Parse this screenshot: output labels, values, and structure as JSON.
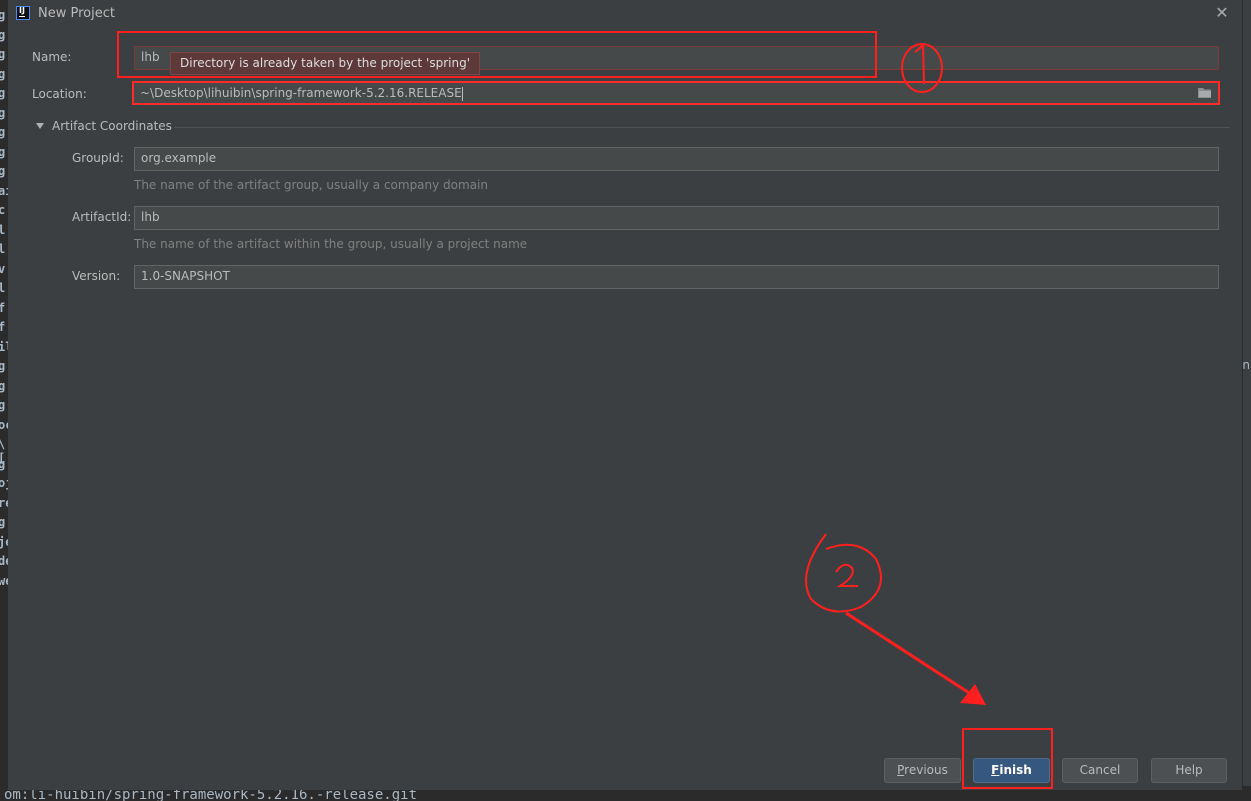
{
  "window": {
    "title": "New Project"
  },
  "form": {
    "name_label": "Name:",
    "name_value": "lhb",
    "name_error_tooltip": "Directory is already taken by the project 'spring'",
    "location_label": "Location:",
    "location_value": "~\\Desktop\\lihuibin\\spring-framework-5.2.16.RELEASE"
  },
  "artifact": {
    "section_title": "Artifact Coordinates",
    "groupid_label": "GroupId:",
    "groupid_value": "org.example",
    "groupid_hint": "The name of the artifact group, usually a company domain",
    "artifactid_label": "ArtifactId:",
    "artifactid_value": "lhb",
    "artifactid_hint": "The name of the artifact within the group, usually a project name",
    "version_label": "Version:",
    "version_value": "1.0-SNAPSHOT"
  },
  "buttons": {
    "previous_first": "P",
    "previous_rest": "revious",
    "finish_first": "F",
    "finish_rest": "inish",
    "cancel": "Cancel",
    "help": "Help"
  },
  "background": {
    "bottom_text": "om:li-huibin/spring-framework-5.2.16.-release.git",
    "left_glyphs": [
      "g",
      "g",
      "g",
      "g",
      "g",
      "g",
      "g",
      "g",
      "g",
      "ail",
      "c",
      "l",
      "l",
      "v",
      "l",
      "f",
      "f",
      "il",
      "g",
      "g",
      "g",
      "oc",
      "\\[",
      "g",
      "oj",
      "re",
      "g",
      "je",
      "de",
      "we"
    ],
    "right_glyph": "n"
  },
  "annotations": {
    "color": "#ff1f1f",
    "mark_one": "1",
    "mark_two": "2"
  }
}
